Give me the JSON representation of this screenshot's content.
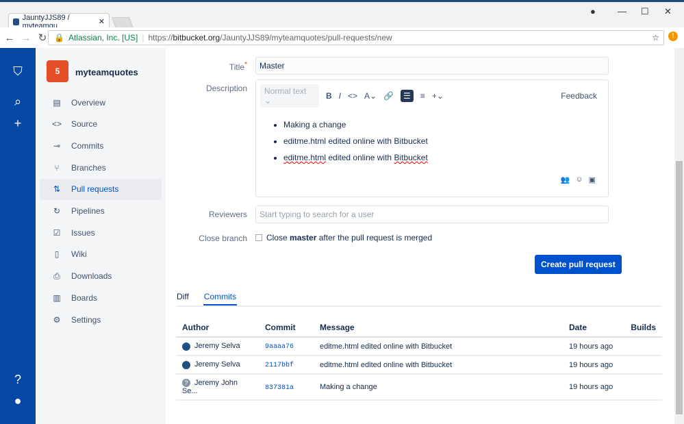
{
  "browser": {
    "tab_title": "JauntyJJS89 / myteamqu",
    "security_label": "Atlassian, Inc. [US]",
    "url_scheme": "https://",
    "url_domain": "bitbucket.org",
    "url_path": "/JauntyJJS89/myteamquotes/pull-requests/new"
  },
  "project": {
    "name": "myteamquotes",
    "logo": "5"
  },
  "nav": [
    {
      "label": "Overview",
      "icon": "▤"
    },
    {
      "label": "Source",
      "icon": "<>"
    },
    {
      "label": "Commits",
      "icon": "⊸"
    },
    {
      "label": "Branches",
      "icon": "⑂"
    },
    {
      "label": "Pull requests",
      "icon": "⇅"
    },
    {
      "label": "Pipelines",
      "icon": "↻"
    },
    {
      "label": "Issues",
      "icon": "☑"
    },
    {
      "label": "Wiki",
      "icon": "▯"
    },
    {
      "label": "Downloads",
      "icon": "⎙"
    },
    {
      "label": "Boards",
      "icon": "▥"
    },
    {
      "label": "Settings",
      "icon": "⚙"
    }
  ],
  "form": {
    "title_label": "Title",
    "title_value": "Master",
    "description_label": "Description",
    "reviewers_label": "Reviewers",
    "reviewers_placeholder": "Start typing to search for a user",
    "close_branch_label": "Close branch",
    "close_pre": "Close",
    "close_branch": "master",
    "close_post": "after the pull request is merged",
    "submit": "Create pull request"
  },
  "editor": {
    "style": "Normal text",
    "feedback": "Feedback",
    "items": [
      "Making a change",
      "editme.html edited online with Bitbucket"
    ],
    "last_a": "editme.html",
    "last_b": " edited online with ",
    "last_c": "Bitbucket"
  },
  "tabs": {
    "diff": "Diff",
    "commits": "Commits"
  },
  "table": {
    "headers": [
      "Author",
      "Commit",
      "Message",
      "Date",
      "Builds"
    ],
    "rows": [
      {
        "author": "Jeremy Selva",
        "commit": "9aaaa76",
        "message": "editme.html edited online with Bitbucket",
        "date": "19 hours ago"
      },
      {
        "author": "Jeremy Selva",
        "commit": "2117bbf",
        "message": "editme.html edited online with Bitbucket",
        "date": "19 hours ago"
      },
      {
        "author": "Jeremy John Se...",
        "commit": "837381a",
        "message": "Making a change",
        "date": "19 hours ago"
      }
    ]
  }
}
